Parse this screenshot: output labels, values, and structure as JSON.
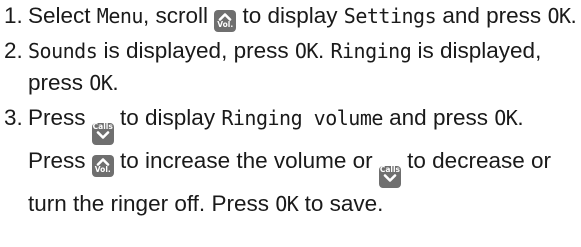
{
  "steps": [
    {
      "num": "1.",
      "parts": [
        {
          "t": "text",
          "v": "Select "
        },
        {
          "t": "screen",
          "v": "Menu"
        },
        {
          "t": "text",
          "v": ", scroll "
        },
        {
          "t": "key",
          "kind": "up",
          "label": "Vol.",
          "icon": "chevron-up-icon"
        },
        {
          "t": "text",
          "v": " to display "
        },
        {
          "t": "screen",
          "v": "Settings"
        },
        {
          "t": "text",
          "v": " and press "
        },
        {
          "t": "screen",
          "v": "OK"
        },
        {
          "t": "text",
          "v": "."
        }
      ]
    },
    {
      "num": "2.",
      "parts": [
        {
          "t": "screen",
          "v": "Sounds"
        },
        {
          "t": "text",
          "v": " is displayed, press "
        },
        {
          "t": "screen",
          "v": "OK"
        },
        {
          "t": "text",
          "v": ". "
        },
        {
          "t": "screen",
          "v": "Ringing"
        },
        {
          "t": "text",
          "v": " is displayed, press "
        },
        {
          "t": "screen",
          "v": "OK"
        },
        {
          "t": "text",
          "v": "."
        }
      ]
    },
    {
      "num": "3.",
      "parts": [
        {
          "t": "text",
          "v": "Press "
        },
        {
          "t": "key",
          "kind": "down",
          "label": "Calls",
          "icon": "chevron-down-icon"
        },
        {
          "t": "text",
          "v": " to display "
        },
        {
          "t": "screen",
          "v": "Ringing volume"
        },
        {
          "t": "text",
          "v": " and press "
        },
        {
          "t": "screen",
          "v": "OK"
        },
        {
          "t": "text",
          "v": ". Press "
        },
        {
          "t": "key",
          "kind": "up",
          "label": "Vol.",
          "icon": "chevron-up-icon"
        },
        {
          "t": "text",
          "v": " to increase the volume or "
        },
        {
          "t": "key",
          "kind": "down",
          "label": "Calls",
          "icon": "chevron-down-icon"
        },
        {
          "t": "text",
          "v": " to decrease or turn the ringer off. Press "
        },
        {
          "t": "screen",
          "v": "OK"
        },
        {
          "t": "text",
          "v": " to save."
        }
      ]
    }
  ],
  "colors": {
    "key_bg": "#6f6f6f",
    "key_fg": "#ffffff",
    "text": "#1a1a1a"
  }
}
